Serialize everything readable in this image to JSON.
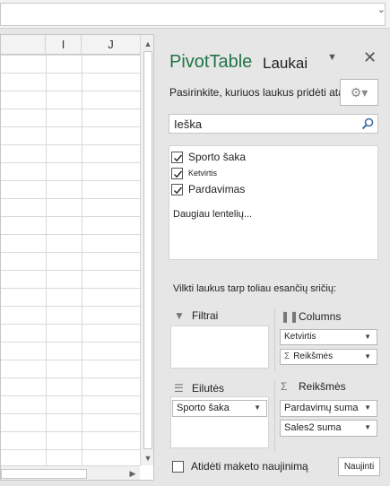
{
  "sheet": {
    "columns": [
      {
        "label": ""
      },
      {
        "label": "I"
      },
      {
        "label": "J"
      }
    ]
  },
  "pivot": {
    "title": "PivotTable",
    "title_bold": "Laukai",
    "dropdown_icon": "chevron-down-icon",
    "close_icon": "close-icon",
    "instruction": "Pasirinkite, kuriuos laukus pridėti ataskaitoje:",
    "gear_icon": "gear-icon",
    "search": {
      "value": "Ieška",
      "icon": "search-icon"
    },
    "fields": [
      {
        "label": "Sporto šaka",
        "checked": true
      },
      {
        "label": "Ketvirtis",
        "checked": true
      },
      {
        "label": "Pardavimas",
        "checked": true
      }
    ],
    "more_tables": "Daugiau lentelių...",
    "drag_instruction": "Vilkti laukus tarp toliau esančių sričių:",
    "areas": {
      "filters": {
        "label": "Filtrai",
        "icon": "filter-icon"
      },
      "columns": {
        "label": "Columns",
        "icon": "columns-icon",
        "items": [
          "Ketvirtis",
          "Reikšmės"
        ]
      },
      "rows": {
        "label": "Eilutės",
        "icon": "rows-icon",
        "items": [
          "Sporto šaka"
        ]
      },
      "values": {
        "label": "Reikšmės",
        "icon": "sigma-icon",
        "items": [
          "Pardavimų suma",
          "Sales2 suma"
        ]
      }
    },
    "defer_label": "Atidėti maketo naujinimą",
    "update_button": "Naujinti"
  },
  "colors": {
    "accent": "#217346",
    "pane_bg": "#e6e6e6"
  }
}
